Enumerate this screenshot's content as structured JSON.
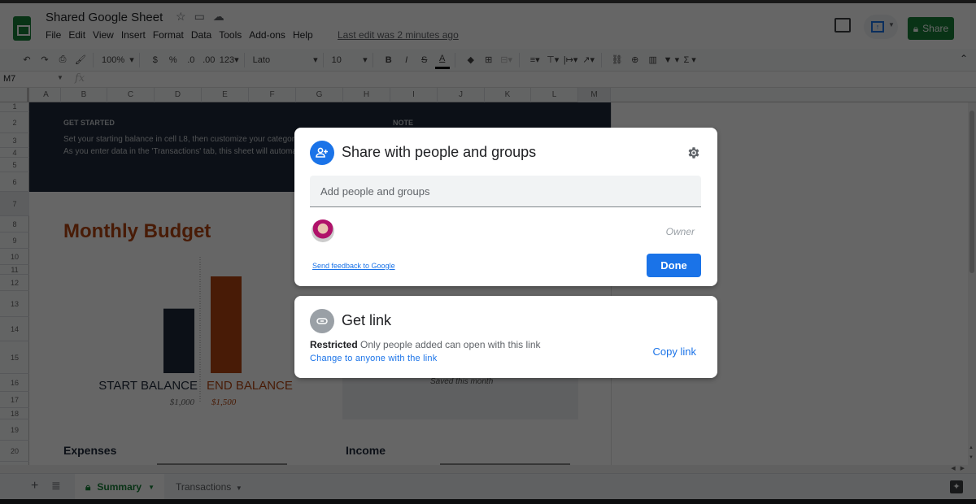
{
  "app": {
    "doc_title": "Shared Google Sheet",
    "menu": [
      "File",
      "Edit",
      "View",
      "Insert",
      "Format",
      "Data",
      "Tools",
      "Add-ons",
      "Help"
    ],
    "last_edit": "Last edit was 2 minutes ago",
    "share_button": "Share",
    "accent_color": "#188038"
  },
  "toolbar": {
    "zoom": "100%",
    "currency": "$",
    "percent": "%",
    "decrease_decimal": ".0",
    "increase_decimal": ".00",
    "more_formats": "123",
    "font": "Lato",
    "font_size": "10",
    "bold": "B",
    "italic": "I",
    "strikethrough": "S",
    "text_color": "A"
  },
  "formula_bar": {
    "cell_ref": "M7",
    "fx": "fx",
    "value": ""
  },
  "columns": [
    "A",
    "B",
    "C",
    "D",
    "E",
    "F",
    "G",
    "H",
    "I",
    "J",
    "K",
    "L",
    "M"
  ],
  "rows": [
    "1",
    "2",
    "3",
    "4",
    "5",
    "6",
    "7",
    "8",
    "9",
    "10",
    "11",
    "12",
    "13",
    "14",
    "15",
    "16",
    "17",
    "18",
    "19",
    "20"
  ],
  "sheet": {
    "get_started": "GET STARTED",
    "get_started_p1": "Set your starting balance in cell L8, then customize your categories and planned spending amounts in the 'Income' and 'Expenses' tables below.",
    "get_started_p2": "As you enter data in the 'Transactions' tab, this sheet will automatically update to show a summary of your spending for the month.",
    "note": "NOTE",
    "title": "Monthly Budget",
    "saved_this_month": "Saved this month",
    "expenses": "Expenses",
    "income": "Income"
  },
  "chart_data": {
    "type": "bar",
    "categories": [
      "START BALANCE",
      "END BALANCE"
    ],
    "values": [
      1000,
      1500
    ],
    "value_labels": [
      "$1,000",
      "$1,500"
    ],
    "colors": [
      "#1e2a3a",
      "#b5440f"
    ],
    "title": "",
    "xlabel": "",
    "ylabel": "",
    "ylim": [
      0,
      1500
    ]
  },
  "sheet_tabs": [
    {
      "label": "Summary",
      "active": true,
      "locked": true
    },
    {
      "label": "Transactions",
      "active": false,
      "locked": false
    }
  ],
  "share_dialog": {
    "title": "Share with people and groups",
    "add_placeholder": "Add people and groups",
    "owner_role": "Owner",
    "feedback_link": "Send feedback to Google",
    "done_button": "Done"
  },
  "link_dialog": {
    "title": "Get link",
    "restriction": "Restricted",
    "restriction_desc": "Only people added can open with this link",
    "change_link": "Change to anyone with the link",
    "copy_link": "Copy link"
  }
}
